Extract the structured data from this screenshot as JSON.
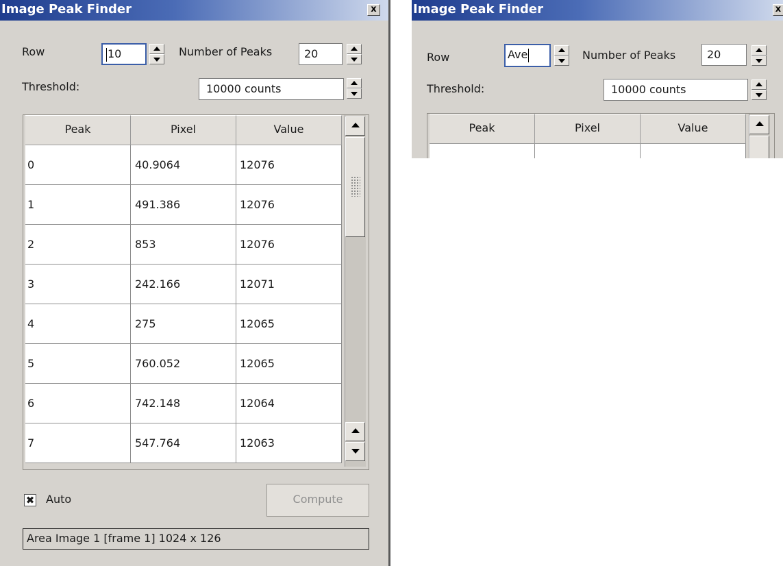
{
  "window_left": {
    "title": "Image Peak Finder",
    "close_label": "x",
    "row_label": "Row",
    "row_value": "10",
    "num_peaks_label": "Number of Peaks",
    "num_peaks_value": "20",
    "threshold_label": "Threshold:",
    "threshold_value": "10000 counts",
    "columns": [
      "Peak",
      "Pixel",
      "Value"
    ],
    "rows": [
      [
        "0",
        "40.9064",
        "12076"
      ],
      [
        "1",
        "491.386",
        "12076"
      ],
      [
        "2",
        "853",
        "12076"
      ],
      [
        "3",
        "242.166",
        "12071"
      ],
      [
        "4",
        "275",
        "12065"
      ],
      [
        "5",
        "760.052",
        "12065"
      ],
      [
        "6",
        "742.148",
        "12064"
      ],
      [
        "7",
        "547.764",
        "12063"
      ]
    ],
    "auto_label": "Auto",
    "auto_checked": true,
    "compute_label": "Compute",
    "status_text": "Area Image 1 [frame 1]  1024 x 126"
  },
  "window_right": {
    "title": "Image Peak Finder",
    "close_label": "x",
    "row_label": "Row",
    "row_value": "Ave",
    "num_peaks_label": "Number of Peaks",
    "num_peaks_value": "20",
    "threshold_label": "Threshold:",
    "threshold_value": "10000 counts",
    "columns": [
      "Peak",
      "Pixel",
      "Value"
    ]
  },
  "colors": {
    "titlebar_start": "#1f3d8e",
    "titlebar_end": "#cfd9ec",
    "window_bg": "#d6d3ce",
    "focus_border": "#3b5ea8"
  }
}
